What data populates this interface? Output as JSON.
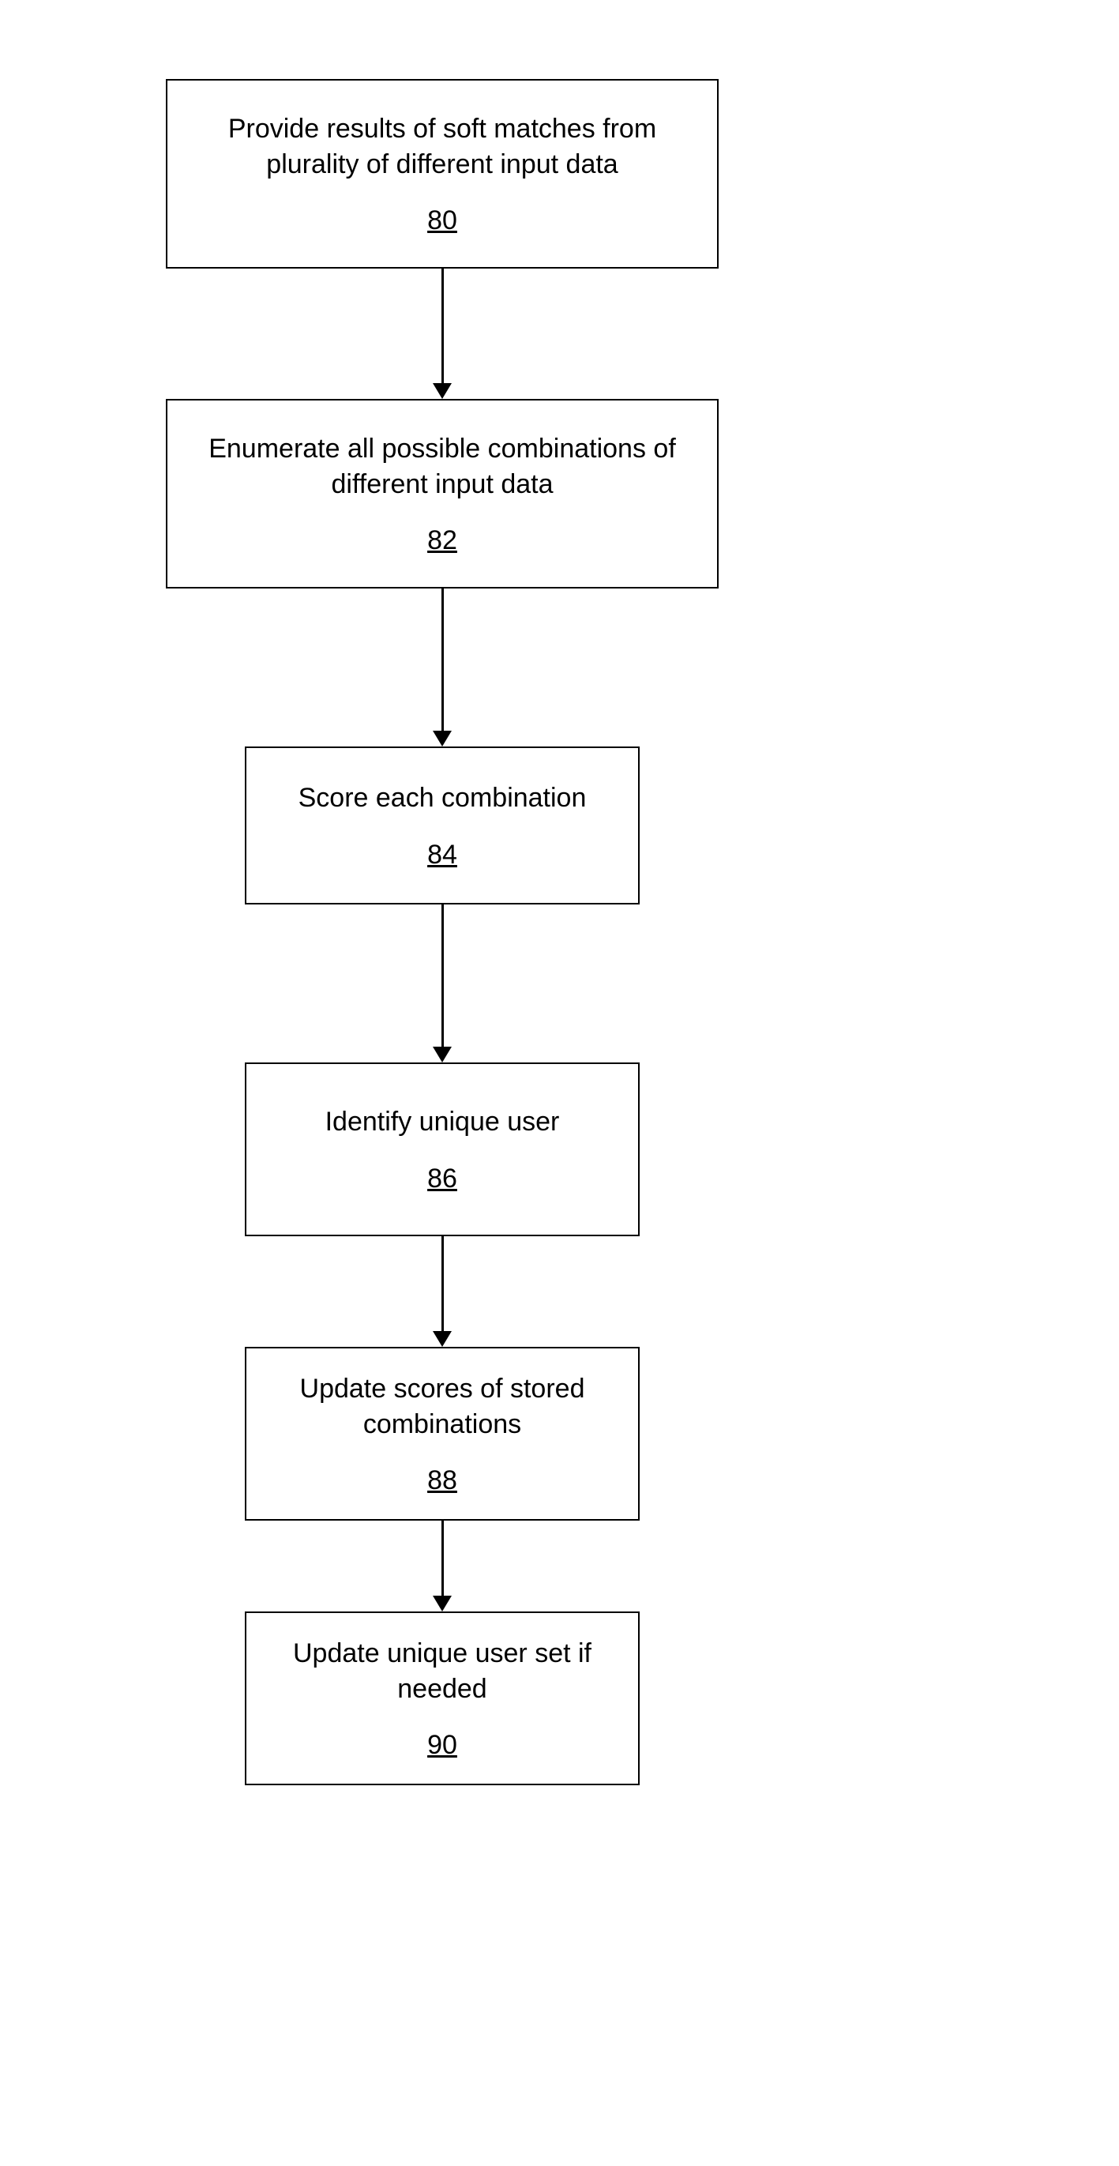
{
  "flowchart": {
    "type": "process-flow",
    "direction": "top-to-bottom",
    "steps": [
      {
        "text": "Provide results of soft matches from plurality of different input data",
        "ref": "80"
      },
      {
        "text": "Enumerate all possible combinations of different input data",
        "ref": "82"
      },
      {
        "text": "Score each combination",
        "ref": "84"
      },
      {
        "text": "Identify unique user",
        "ref": "86"
      },
      {
        "text": "Update scores of stored combinations",
        "ref": "88"
      },
      {
        "text": "Update unique user set if needed",
        "ref": "90"
      }
    ]
  }
}
